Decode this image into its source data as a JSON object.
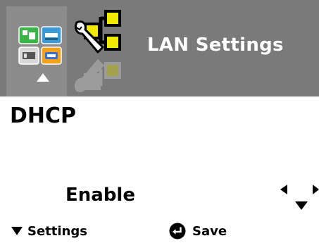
{
  "header": {
    "title": "LAN Settings",
    "menu_icon": "printer-menu-grid-icon",
    "menu_indicator_icon": "up-arrow-icon",
    "section_icon": "wrench-network-icon"
  },
  "field": {
    "title": "DHCP",
    "value": "Enable",
    "nav_icons": [
      "left-arrow-icon",
      "right-arrow-icon",
      "down-arrow-icon"
    ]
  },
  "softkeys": {
    "left": {
      "label": "Settings",
      "icon": "down-triangle-icon"
    },
    "right": {
      "label": "Save",
      "icon": "enter-icon"
    }
  },
  "colors": {
    "header_bg": "#7a7a7a",
    "menu_tile_bg": "#8c8c8c",
    "icon_yellow": "#f2ea00",
    "icon_green": "#3bb54a",
    "icon_blue": "#3c9ad6",
    "icon_orange": "#f2a21b",
    "text": "#000000"
  }
}
